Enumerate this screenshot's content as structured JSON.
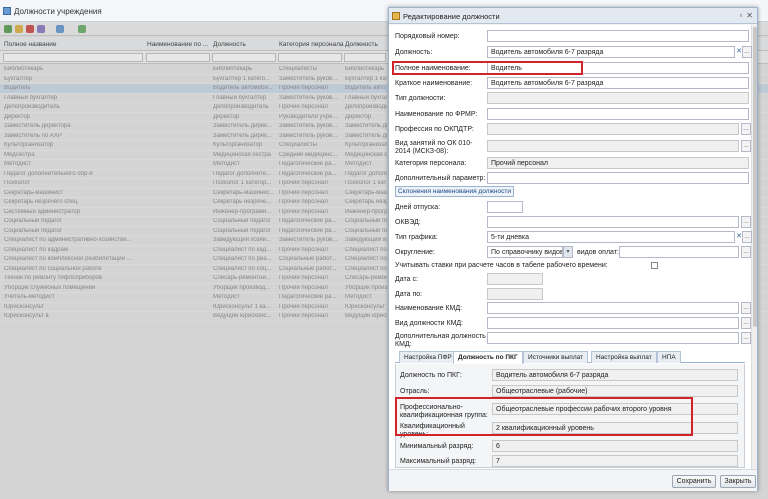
{
  "background": {
    "title": "Должности учреждения",
    "columns": [
      "Полное название",
      "Наименование по ...",
      "Должность",
      "Категория персонала",
      "Должность"
    ],
    "rows": [
      [
        "Библиотекарь",
        "",
        "Библиотекарь",
        "Специалисты",
        "Библиотекарь"
      ],
      [
        "Бухгалтер",
        "",
        "Бухгалтер 1 катего...",
        "Заместитель руков...",
        "Бухгалтер 1 кат"
      ],
      [
        "Водитель",
        "",
        "Водитель автомоби...",
        "Прочий персонал",
        "Водитель авто"
      ],
      [
        "Главный бухгалтер",
        "",
        "Главный бухгалтер",
        "Заместитель руков...",
        "Главный бухгал"
      ],
      [
        "Делопроизводитель",
        "",
        "Делопроизводитель",
        "Прочий персонал",
        "Делопроизводит"
      ],
      [
        "Директор",
        "",
        "Директор",
        "Руководители учре...",
        "Директор"
      ],
      [
        "Заместитель директора",
        "",
        "Заместитель дирек...",
        "Заместитель руков...",
        "Заместитель ди"
      ],
      [
        "Заместитель по АХР",
        "",
        "Заместитель дирек...",
        "Заместитель руков...",
        "Заместитель ди"
      ],
      [
        "Культорганизатор",
        "",
        "Культорганизатор",
        "Специалисты",
        "Культорганизат"
      ],
      [
        "Медсестра",
        "",
        "Медицинская сестра",
        "Средний медицинс...",
        "Медицинская се"
      ],
      [
        "Методист",
        "",
        "Методист",
        "Педагогические ра...",
        "Методист"
      ],
      [
        "Педагог дополнительного обр-я",
        "",
        "Педагог дополните...",
        "Педагогические ра...",
        "Педагог дополн"
      ],
      [
        "Психолог",
        "",
        "Психолог 1 категор...",
        "Прочий персонал",
        "Психолог 1 кат"
      ],
      [
        "Секретарь-машинист",
        "",
        "Секретарь-машинис...",
        "Прочий персонал",
        "Секретарь-маши"
      ],
      [
        "Секретарь незрячего спец.",
        "",
        "Секретарь незряче...",
        "Прочий персонал",
        "Секретарь незр"
      ],
      [
        "Системный администратор",
        "",
        "Инженер-програми...",
        "Прочий персонал",
        "Инженер-прогр"
      ],
      [
        "Социальный педагог",
        "",
        "Социальный педагог",
        "Педагогические ра...",
        "Социальный пед"
      ],
      [
        "Социальный педагог",
        "",
        "Социальный педагог",
        "Педагогические ра...",
        "Социальный пед"
      ],
      [
        "Специалист по административно-хозяйстве...",
        "",
        "Заведующий хозяй...",
        "Заместитель руков...",
        "Заведующий хоз"
      ],
      [
        "Специалист по кадрам",
        "",
        "Специалист по кад...",
        "Прочий персонал",
        "Специалист по к"
      ],
      [
        "Специалист по комплексной реабилитации ...",
        "",
        "Специалист по реа...",
        "Социальные работ...",
        "Специалист по р"
      ],
      [
        "Специалист по социальной работе",
        "",
        "Специалист по соц...",
        "Социальные работ...",
        "Специалист по с"
      ],
      [
        "Техник по ремонту тифлоприборов",
        "",
        "Слесарь-ремонтни...",
        "Прочий персонал",
        "Слесарь-ремонт"
      ],
      [
        "Уборщик служебных помещений",
        "",
        "Уборщик производ...",
        "Прочий персонал",
        "Уборщик произв"
      ],
      [
        "Учитель-методист",
        "",
        "Методист",
        "Педагогические ра...",
        "Методист"
      ],
      [
        "Юрисконсульт",
        "",
        "Юрисконсульт 1 ка...",
        "Прочий персонал",
        "Юрисконсульт 1"
      ],
      [
        "Юрисконсульт в",
        "",
        "Ведущий юрисконс...",
        "Прочий персонал",
        "Ведущий юриско"
      ]
    ]
  },
  "dialog": {
    "title": "Редактирование должности",
    "fields": {
      "order_number": {
        "label": "Порядковый номер:",
        "value": ""
      },
      "position": {
        "label": "Должность:",
        "value": "Водитель автомобиля 6-7 разряда"
      },
      "full_name": {
        "label": "Полное наименование:",
        "value": "Водитель"
      },
      "short_name": {
        "label": "Краткое наименование:",
        "value": "Водитель автомобиля 6-7 разряда"
      },
      "position_type": {
        "label": "Тип должности:",
        "value": ""
      },
      "frmr_name": {
        "label": "Наименование по ФРМР:",
        "value": ""
      },
      "okpdtr": {
        "label": "Профессия по ОКПДТР:",
        "value": ""
      },
      "okz": {
        "label": "Вид занятий по ОК 010-2014 (МСКЗ-08):",
        "value": ""
      },
      "staff_category": {
        "label": "Категория персонала:",
        "value": "Прочий персонал"
      },
      "extra_param": {
        "label": "Дополнительный параметр:",
        "value": ""
      },
      "declension_button": "Склонения наименования должности",
      "vacation_days": {
        "label": "Дней отпуска:",
        "value": ""
      },
      "okved": {
        "label": "ОКВЭД:",
        "value": ""
      },
      "schedule_type": {
        "label": "Тип графика:",
        "value": "5-ти дневка"
      },
      "rounding": {
        "label": "Округление:",
        "value": "По справочнику видов о",
        "payment_label": "видов оплат:"
      },
      "consider_rates": {
        "label": "Учитывать ставки при расчете часов в табеле рабочего времени:"
      },
      "date_from": {
        "label": "Дата с:",
        "value": ""
      },
      "date_to": {
        "label": "Дата по:",
        "value": ""
      },
      "kmd_name": {
        "label": "Наименование КМД:",
        "value": ""
      },
      "kmd_type": {
        "label": "Вид должности КМД:",
        "value": ""
      },
      "kmd_extra": {
        "label": "Дополнительная должность КМД:",
        "value": ""
      }
    },
    "tabs": [
      "Настройка ПФР",
      "Должность по ПКГ",
      "Источники выплат",
      "Настройка выплат",
      "НПА"
    ],
    "pkg": {
      "position_pkg": {
        "label": "Должность по ПКГ:",
        "value": "Водитель автомобиля 6-7 разряда"
      },
      "industry": {
        "label": "Отрасль:",
        "value": "Общеотраслевые (рабочие)"
      },
      "prof_group": {
        "label": "Профессионально-квалификационная группа:",
        "value": "Общеотраслевые профессии рабочих второго уровня"
      },
      "qual_level": {
        "label": "Квалификационный уровень:",
        "value": "2 квалификационный уровень"
      },
      "min_grade": {
        "label": "Минимальный разряд:",
        "value": "6"
      },
      "max_grade": {
        "label": "Максимальный разряд:",
        "value": "7"
      }
    },
    "buttons": {
      "save": "Сохранить",
      "close": "Закрыть"
    }
  },
  "colors": {
    "highlight": "#d0232a",
    "accent": "#2d5fa0"
  }
}
